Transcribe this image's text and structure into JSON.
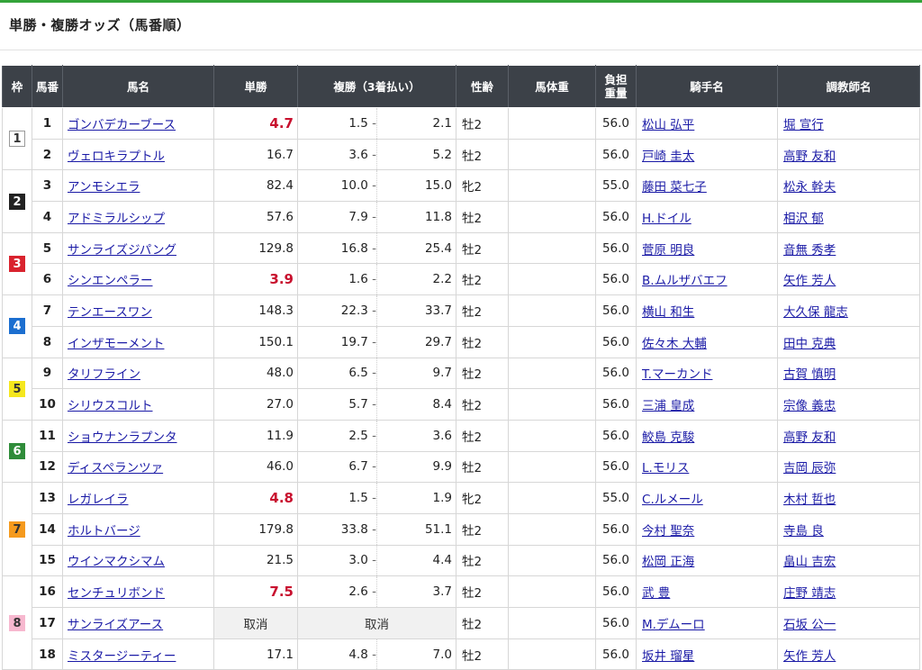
{
  "title": "単勝・複勝オッズ（馬番順）",
  "columns": {
    "waku": "枠",
    "umaban": "馬番",
    "name": "馬名",
    "win": "単勝",
    "place": "複勝（3着払い）",
    "sex_age": "性齢",
    "body_weight": "馬体重",
    "burden_l1": "負担",
    "burden_l2": "重量",
    "jockey": "騎手名",
    "trainer": "調教師名"
  },
  "waku_colors": {
    "1": {
      "bg": "#ffffff",
      "fg": "#333333",
      "border": "#999999"
    },
    "2": {
      "bg": "#222222",
      "fg": "#ffffff",
      "border": "#222222"
    },
    "3": {
      "bg": "#d9232e",
      "fg": "#ffffff",
      "border": "#d9232e"
    },
    "4": {
      "bg": "#1c6fd0",
      "fg": "#ffffff",
      "border": "#1c6fd0"
    },
    "5": {
      "bg": "#f5e71e",
      "fg": "#333333",
      "border": "#f5e71e"
    },
    "6": {
      "bg": "#2f8c3a",
      "fg": "#ffffff",
      "border": "#2f8c3a"
    },
    "7": {
      "bg": "#f59a1e",
      "fg": "#333333",
      "border": "#f59a1e"
    },
    "8": {
      "bg": "#f7b8cf",
      "fg": "#333333",
      "border": "#f7b8cf"
    }
  },
  "rows": [
    {
      "waku": "1",
      "num": "1",
      "name": "ゴンバデカーブース",
      "win": "4.7",
      "fav": true,
      "place_lo": "1.5",
      "place_hi": "2.1",
      "sex_age": "牡2",
      "body_weight": "",
      "burden": "56.0",
      "jockey": "松山 弘平",
      "trainer": "堀 宣行"
    },
    {
      "waku": "1",
      "num": "2",
      "name": "ヴェロキラプトル",
      "win": "16.7",
      "fav": false,
      "place_lo": "3.6",
      "place_hi": "5.2",
      "sex_age": "牡2",
      "body_weight": "",
      "burden": "56.0",
      "jockey": "戸崎 圭太",
      "trainer": "高野 友和"
    },
    {
      "waku": "2",
      "num": "3",
      "name": "アンモシエラ",
      "win": "82.4",
      "fav": false,
      "place_lo": "10.0",
      "place_hi": "15.0",
      "sex_age": "牝2",
      "body_weight": "",
      "burden": "55.0",
      "jockey": "藤田 菜七子",
      "trainer": "松永 幹夫"
    },
    {
      "waku": "2",
      "num": "4",
      "name": "アドミラルシップ",
      "win": "57.6",
      "fav": false,
      "place_lo": "7.9",
      "place_hi": "11.8",
      "sex_age": "牡2",
      "body_weight": "",
      "burden": "56.0",
      "jockey": "H.ドイル",
      "trainer": "相沢 郁"
    },
    {
      "waku": "3",
      "num": "5",
      "name": "サンライズジパング",
      "win": "129.8",
      "fav": false,
      "place_lo": "16.8",
      "place_hi": "25.4",
      "sex_age": "牡2",
      "body_weight": "",
      "burden": "56.0",
      "jockey": "菅原 明良",
      "trainer": "音無 秀孝"
    },
    {
      "waku": "3",
      "num": "6",
      "name": "シンエンペラー",
      "win": "3.9",
      "fav": true,
      "place_lo": "1.6",
      "place_hi": "2.2",
      "sex_age": "牡2",
      "body_weight": "",
      "burden": "56.0",
      "jockey": "B.ムルザバエフ",
      "trainer": "矢作 芳人"
    },
    {
      "waku": "4",
      "num": "7",
      "name": "テンエースワン",
      "win": "148.3",
      "fav": false,
      "place_lo": "22.3",
      "place_hi": "33.7",
      "sex_age": "牡2",
      "body_weight": "",
      "burden": "56.0",
      "jockey": "横山 和生",
      "trainer": "大久保 龍志"
    },
    {
      "waku": "4",
      "num": "8",
      "name": "インザモーメント",
      "win": "150.1",
      "fav": false,
      "place_lo": "19.7",
      "place_hi": "29.7",
      "sex_age": "牡2",
      "body_weight": "",
      "burden": "56.0",
      "jockey": "佐々木 大輔",
      "trainer": "田中 克典"
    },
    {
      "waku": "5",
      "num": "9",
      "name": "タリフライン",
      "win": "48.0",
      "fav": false,
      "place_lo": "6.5",
      "place_hi": "9.7",
      "sex_age": "牡2",
      "body_weight": "",
      "burden": "56.0",
      "jockey": "T.マーカンド",
      "trainer": "古賀 慎明"
    },
    {
      "waku": "5",
      "num": "10",
      "name": "シリウスコルト",
      "win": "27.0",
      "fav": false,
      "place_lo": "5.7",
      "place_hi": "8.4",
      "sex_age": "牡2",
      "body_weight": "",
      "burden": "56.0",
      "jockey": "三浦 皇成",
      "trainer": "宗像 義忠"
    },
    {
      "waku": "6",
      "num": "11",
      "name": "ショウナンラプンタ",
      "win": "11.9",
      "fav": false,
      "place_lo": "2.5",
      "place_hi": "3.6",
      "sex_age": "牡2",
      "body_weight": "",
      "burden": "56.0",
      "jockey": "鮫島 克駿",
      "trainer": "高野 友和"
    },
    {
      "waku": "6",
      "num": "12",
      "name": "ディスペランツァ",
      "win": "46.0",
      "fav": false,
      "place_lo": "6.7",
      "place_hi": "9.9",
      "sex_age": "牡2",
      "body_weight": "",
      "burden": "56.0",
      "jockey": "L.モリス",
      "trainer": "吉岡 辰弥"
    },
    {
      "waku": "7",
      "num": "13",
      "name": "レガレイラ",
      "win": "4.8",
      "fav": true,
      "place_lo": "1.5",
      "place_hi": "1.9",
      "sex_age": "牝2",
      "body_weight": "",
      "burden": "55.0",
      "jockey": "C.ルメール",
      "trainer": "木村 哲也"
    },
    {
      "waku": "7",
      "num": "14",
      "name": "ホルトバージ",
      "win": "179.8",
      "fav": false,
      "place_lo": "33.8",
      "place_hi": "51.1",
      "sex_age": "牡2",
      "body_weight": "",
      "burden": "56.0",
      "jockey": "今村 聖奈",
      "trainer": "寺島 良"
    },
    {
      "waku": "7",
      "num": "15",
      "name": "ウインマクシマム",
      "win": "21.5",
      "fav": false,
      "place_lo": "3.0",
      "place_hi": "4.4",
      "sex_age": "牡2",
      "body_weight": "",
      "burden": "56.0",
      "jockey": "松岡 正海",
      "trainer": "畠山 吉宏"
    },
    {
      "waku": "8",
      "num": "16",
      "name": "センチュリボンド",
      "win": "7.5",
      "fav": true,
      "place_lo": "2.6",
      "place_hi": "3.7",
      "sex_age": "牡2",
      "body_weight": "",
      "burden": "56.0",
      "jockey": "武 豊",
      "trainer": "庄野 靖志"
    },
    {
      "waku": "8",
      "num": "17",
      "name": "サンライズアース",
      "win": "取消",
      "fav": false,
      "scratched": true,
      "place_lo": "取消",
      "place_hi": "",
      "sex_age": "牡2",
      "body_weight": "",
      "burden": "56.0",
      "jockey": "M.デムーロ",
      "trainer": "石坂 公一"
    },
    {
      "waku": "8",
      "num": "18",
      "name": "ミスタージーティー",
      "win": "17.1",
      "fav": false,
      "place_lo": "4.8",
      "place_hi": "7.0",
      "sex_age": "牡2",
      "body_weight": "",
      "burden": "56.0",
      "jockey": "坂井 瑠星",
      "trainer": "矢作 芳人"
    }
  ]
}
